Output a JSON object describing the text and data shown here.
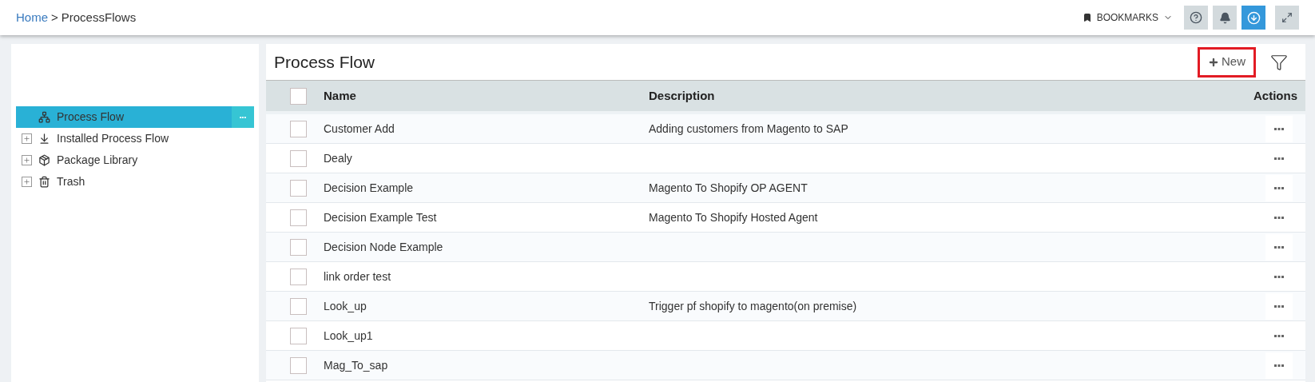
{
  "breadcrumb": {
    "items": [
      "Home",
      "ProcessFlows"
    ],
    "separator": ">"
  },
  "top_bar": {
    "bookmarks": "BOOKMARKS"
  },
  "sidebar": {
    "items": [
      {
        "label": "Process Flow",
        "selected": true,
        "more": "•••"
      },
      {
        "label": "Installed Process Flow",
        "selected": false,
        "expanded": false
      },
      {
        "label": "Package Library",
        "selected": false,
        "expanded": false
      },
      {
        "label": "Trash",
        "selected": false,
        "expanded": false
      }
    ]
  },
  "panel": {
    "title": "Process Flow",
    "new_button": "New"
  },
  "table": {
    "header_checked": false,
    "columns": [
      "Name",
      "Description",
      "Actions"
    ],
    "rows": [
      {
        "name": "Customer Add",
        "description": "Adding customers from Magento to SAP",
        "checked": false
      },
      {
        "name": "Dealy",
        "checked": false
      },
      {
        "name": "Decision Example",
        "description": "Magento To Shopify OP AGENT",
        "checked": false
      },
      {
        "name": "Decision Example Test",
        "description": "Magento To Shopify Hosted Agent",
        "checked": false
      },
      {
        "name": "Decision Node Example",
        "checked": false
      },
      {
        "name": "link order test",
        "checked": false
      },
      {
        "name": "Look_up",
        "description": "Trigger pf shopify to magento(on premise)",
        "checked": false
      },
      {
        "name": "Look_up1",
        "checked": false
      },
      {
        "name": "Mag_To_sap",
        "checked": false
      }
    ]
  }
}
